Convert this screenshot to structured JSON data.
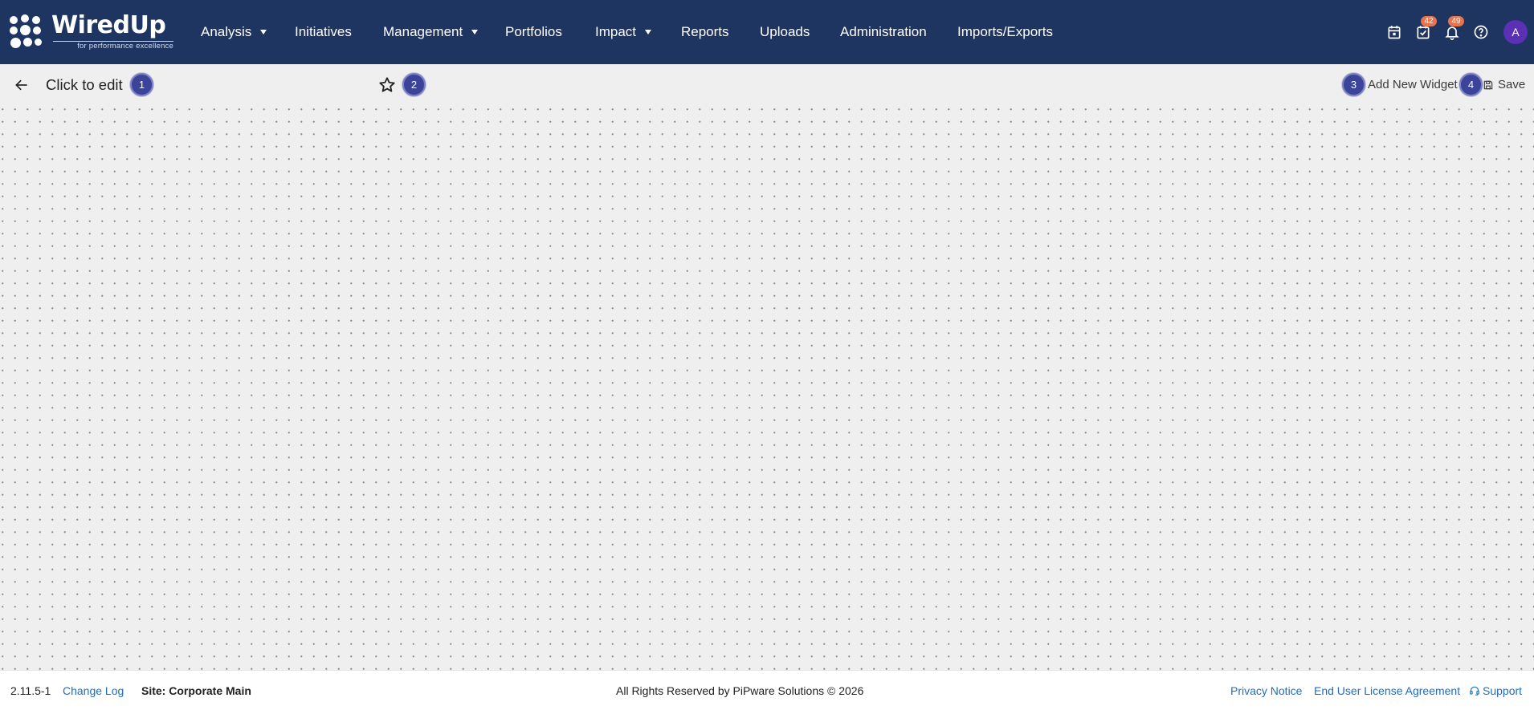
{
  "app": {
    "logo_text": "WiredUp",
    "logo_tagline": "for performance excellence"
  },
  "nav": {
    "items": [
      {
        "label": "Analysis",
        "has_dropdown": true
      },
      {
        "label": "Initiatives",
        "has_dropdown": false
      },
      {
        "label": "Management",
        "has_dropdown": true
      },
      {
        "label": "Portfolios",
        "has_dropdown": false
      },
      {
        "label": "Impact",
        "has_dropdown": true
      },
      {
        "label": "Reports",
        "has_dropdown": false
      },
      {
        "label": "Uploads",
        "has_dropdown": false
      },
      {
        "label": "Administration",
        "has_dropdown": false
      },
      {
        "label": "Imports/Exports",
        "has_dropdown": false
      }
    ],
    "icons": {
      "calendar": "calendar-icon",
      "tasks": "task-check-icon",
      "notifications": "bell-icon",
      "help": "help-circle-icon"
    },
    "tasks_badge": "42",
    "notifications_badge": "49",
    "avatar_initial": "A"
  },
  "toolbar": {
    "title": "Click to edit",
    "steps": [
      "1",
      "2",
      "3",
      "4"
    ],
    "add_widget_label": "Add New Widget",
    "save_label": "Save"
  },
  "footer": {
    "version": "2.11.5-1",
    "changelog_label": "Change Log",
    "site_label": "Site: Corporate Main",
    "copyright": "All Rights Reserved by PiPware Solutions © 2026",
    "privacy_label": "Privacy Notice",
    "eula_label": "End User License Agreement",
    "support_label": "Support"
  },
  "colors": {
    "navbar": "#1e3461",
    "step_badge": "#3b4499",
    "notification_badge": "#e8744f",
    "avatar": "#5a30b5",
    "link": "#1a6fc4"
  }
}
